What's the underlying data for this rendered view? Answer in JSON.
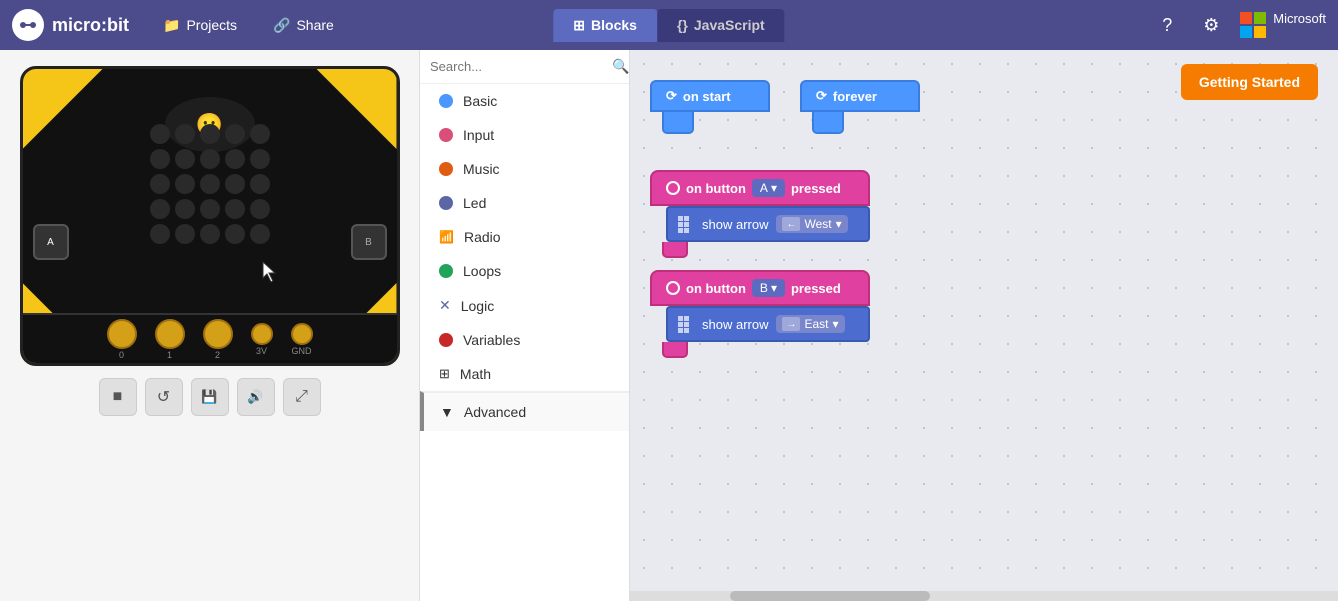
{
  "app": {
    "name": "micro:bit",
    "logo_symbol": "●—●"
  },
  "nav": {
    "projects_label": "Projects",
    "share_label": "Share",
    "blocks_label": "Blocks",
    "javascript_label": "JavaScript",
    "getting_started_label": "Getting Started",
    "active_tab": "blocks"
  },
  "sidebar": {
    "search_placeholder": "Search...",
    "items": [
      {
        "id": "basic",
        "label": "Basic",
        "color": "#4c97ff"
      },
      {
        "id": "input",
        "label": "Input",
        "color": "#d94f7a"
      },
      {
        "id": "music",
        "label": "Music",
        "color": "#e05c10"
      },
      {
        "id": "led",
        "label": "Led",
        "color": "#5b67a5"
      },
      {
        "id": "radio",
        "label": "Radio",
        "color": "#e05c10"
      },
      {
        "id": "loops",
        "label": "Loops",
        "color": "#22a35a"
      },
      {
        "id": "logic",
        "label": "Logic",
        "color": "#5b67a5"
      },
      {
        "id": "variables",
        "label": "Variables",
        "color": "#c62828"
      },
      {
        "id": "math",
        "label": "Math",
        "color": "#5c7aff"
      }
    ],
    "advanced_label": "Advanced",
    "advanced_icon": "▼"
  },
  "blocks": {
    "on_start_label": "on start",
    "forever_label": "forever",
    "block1": {
      "event_label": "on button",
      "button": "A",
      "pressed_label": "pressed",
      "action_label": "show arrow",
      "direction": "West",
      "direction_icon": "←"
    },
    "block2": {
      "event_label": "on button",
      "button": "B",
      "pressed_label": "pressed",
      "action_label": "show arrow",
      "direction": "East",
      "direction_icon": "→"
    }
  },
  "simulator": {
    "controls": [
      {
        "id": "stop",
        "icon": "■",
        "label": "Stop"
      },
      {
        "id": "restart",
        "icon": "↺",
        "label": "Restart"
      },
      {
        "id": "save",
        "icon": "💾",
        "label": "Save"
      },
      {
        "id": "sound",
        "icon": "🔊",
        "label": "Sound"
      },
      {
        "id": "fullscreen",
        "icon": "⤢",
        "label": "Fullscreen"
      }
    ],
    "button_a": "A",
    "button_b": "B",
    "pins": [
      "0",
      "1",
      "2",
      "3V",
      "GND"
    ]
  },
  "colors": {
    "nav_bg": "#4c4c8c",
    "tab_active": "#5c6bc0",
    "tab_inactive": "#3a3a7a",
    "event_block": "#e040a0",
    "event_block_border": "#c0307a",
    "action_block": "#4c6cd0",
    "on_start_block": "#4c97ff",
    "getting_started_btn": "#f57c00",
    "ms_red": "#f25022",
    "ms_green": "#7fba00",
    "ms_blue": "#00a4ef",
    "ms_yellow": "#ffb900"
  }
}
